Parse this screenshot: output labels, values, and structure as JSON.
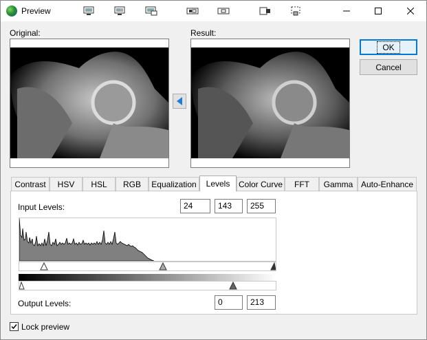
{
  "window": {
    "title": "Preview"
  },
  "toolbar": {
    "icons": [
      "monitor-view-icon",
      "monitor-split-icon",
      "monitor-compare-icon",
      "fit-width-icon",
      "actual-size-icon",
      "fit-page-icon",
      "selection-icon"
    ]
  },
  "original": {
    "label": "Original:"
  },
  "result": {
    "label": "Result:"
  },
  "buttons": {
    "ok": "OK",
    "cancel": "Cancel"
  },
  "tabs": [
    {
      "label": "Contrast"
    },
    {
      "label": "HSV"
    },
    {
      "label": "HSL"
    },
    {
      "label": "RGB"
    },
    {
      "label": "Equalization"
    },
    {
      "label": "Levels"
    },
    {
      "label": "Color Curve"
    },
    {
      "label": "FFT"
    },
    {
      "label": "Gamma"
    },
    {
      "label": "Auto-Enhance"
    }
  ],
  "levels": {
    "input_label": "Input Levels:",
    "input_black": "24",
    "input_gamma": "143",
    "input_white": "255",
    "output_label": "Output Levels:",
    "output_black": "0",
    "output_white": "213"
  },
  "lock_preview": {
    "label": "Lock preview",
    "checked": true
  }
}
